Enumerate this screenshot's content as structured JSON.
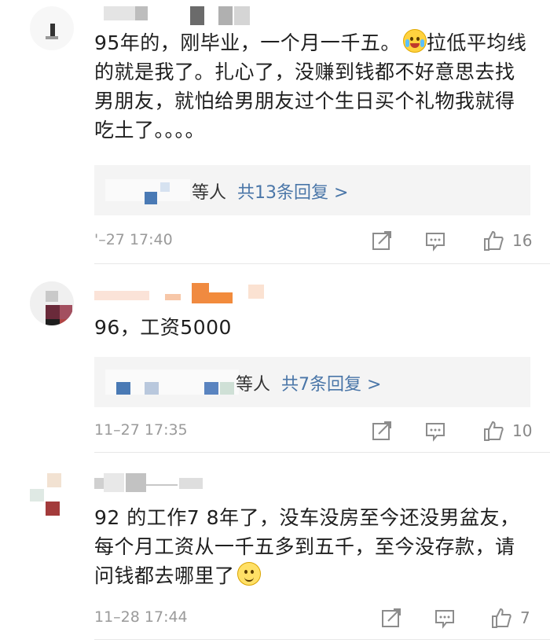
{
  "comments": [
    {
      "text": "95年的，刚毕业，一个月一千五。",
      "text2": "拉低平均线的就是我了。扎心了，没赚到钱都不好意思去找男朋友，就怕给男朋友过个生日买个礼物我就得吃土了。。。。",
      "emoji": "crying-laughing-emoji",
      "reply_label": "等人",
      "reply_link": "共13条回复 >",
      "time": "'–27 17:40",
      "likes": "16"
    },
    {
      "text": "96，工资5000",
      "reply_label": "等人",
      "reply_link": "共7条回复 >",
      "time": "11–27 17:35",
      "likes": "10"
    },
    {
      "text": "92 的工作7 8年了，没车没房至今还没男盆友，每个月工资从一千五多到五千，至今没存款，请问钱都去哪里了",
      "emoji": "smile-emoji",
      "time": "11–28 17:44",
      "likes": "7"
    }
  ],
  "icons": [
    "share-icon",
    "comment-icon",
    "like-icon"
  ],
  "colors": {
    "link": "#4a76a8",
    "meta": "#9a9a9a",
    "reply_bg": "#f4f4f4"
  }
}
